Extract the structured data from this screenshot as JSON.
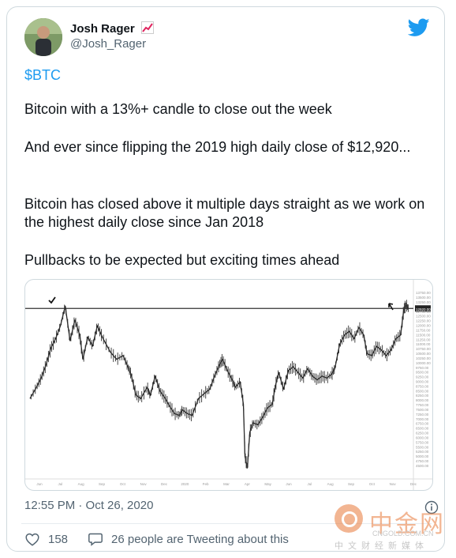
{
  "tweet": {
    "author_name": "Josh Rager",
    "author_handle": "@Josh_Rager",
    "cashtag": "$BTC",
    "paragraphs": [
      "Bitcoin with a 13%+ candle to close out the week",
      "And ever since flipping the 2019 high daily close of $12,920...",
      "Bitcoin has closed above it multiple days straight as we work on the highest daily close since Jan 2018",
      "Pullbacks to be expected but exciting times ahead"
    ],
    "timestamp": "12:55 PM · Oct 26, 2020",
    "likes": "158",
    "tweeting_about": "26 people are Tweeting about this"
  },
  "chart_data": {
    "type": "line",
    "price_axis": [
      "13750.00",
      "13500.00",
      "13250.00",
      "13000.00",
      "12920.00",
      "12750.00",
      "12500.00",
      "12250.00",
      "12000.00",
      "11750.00",
      "11500.00",
      "11250.00",
      "11000.00",
      "10750.00",
      "10500.00",
      "10250.00",
      "10000.00",
      "9750.00",
      "9500.00",
      "9250.00",
      "9000.00",
      "8750.00",
      "8500.00",
      "8250.00",
      "8000.00",
      "7750.00",
      "7500.00",
      "7250.00",
      "7000.00",
      "6750.00",
      "6500.00",
      "6250.00",
      "6000.00",
      "5750.00",
      "5500.00",
      "5250.00",
      "5000.00",
      "4750.00",
      "4500.00"
    ],
    "months": [
      "Jun",
      "Jul",
      "Aug",
      "Sep",
      "Oct",
      "Nov",
      "Dec",
      "2020",
      "Feb",
      "Mar",
      "Apr",
      "May",
      "Jun",
      "Jul",
      "Aug",
      "Sep",
      "Oct",
      "Nov",
      "Dec"
    ],
    "level": 12920,
    "ylim": [
      3800,
      14200
    ]
  },
  "colors": {
    "accent": "#1d9bf0",
    "muted": "#536471",
    "candle": "#222222"
  },
  "watermark": {
    "cn": "中金网",
    "url": "CNGOLD.COM.CN",
    "sub": "中文财经新媒体"
  }
}
